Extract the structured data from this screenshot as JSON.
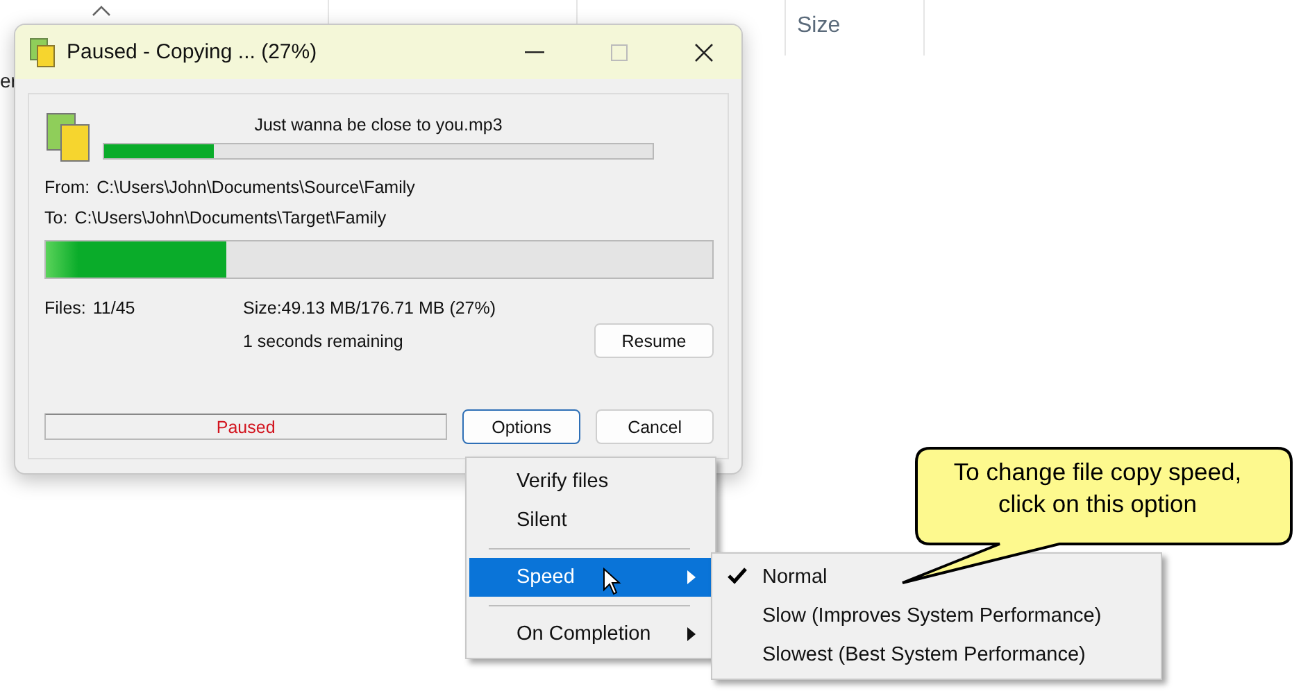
{
  "explorer": {
    "side_text": "er",
    "columns": [
      {
        "label": "Size"
      }
    ]
  },
  "dialog": {
    "title": "Paused - Copying ... (27%)",
    "file_name": "Just wanna be close to you.mp3",
    "file_progress": {
      "level": 0.2
    },
    "from": {
      "label": "From:",
      "path": "C:\\Users\\John\\Documents\\Source\\Family"
    },
    "to": {
      "label": "To:",
      "path": "C:\\Users\\John\\Documents\\Target\\Family"
    },
    "total_progress": {
      "level": 0.27
    },
    "files": {
      "label": "Files:",
      "value": "11/45"
    },
    "size": "Size:49.13 MB/176.71 MB (27%)",
    "remaining": "1 seconds remaining",
    "status": "Paused",
    "buttons": {
      "resume": "Resume",
      "options": "Options",
      "cancel": "Cancel"
    }
  },
  "options_menu": {
    "items": [
      {
        "kind": "item",
        "label": "Verify files",
        "selected": false,
        "submenu": false
      },
      {
        "kind": "item",
        "label": "Silent",
        "selected": false,
        "submenu": false
      },
      {
        "kind": "separator"
      },
      {
        "kind": "item",
        "label": "Speed",
        "selected": true,
        "submenu": true
      },
      {
        "kind": "separator"
      },
      {
        "kind": "item",
        "label": "On Completion",
        "selected": false,
        "submenu": true
      }
    ]
  },
  "speed_menu": {
    "items": [
      {
        "label": "Normal",
        "checked": true
      },
      {
        "label": "Slow (Improves System Performance)",
        "checked": false
      },
      {
        "label": "Slowest (Best System Performance)",
        "checked": false
      }
    ]
  },
  "callout": {
    "text": "To change file copy speed, click on this option"
  }
}
